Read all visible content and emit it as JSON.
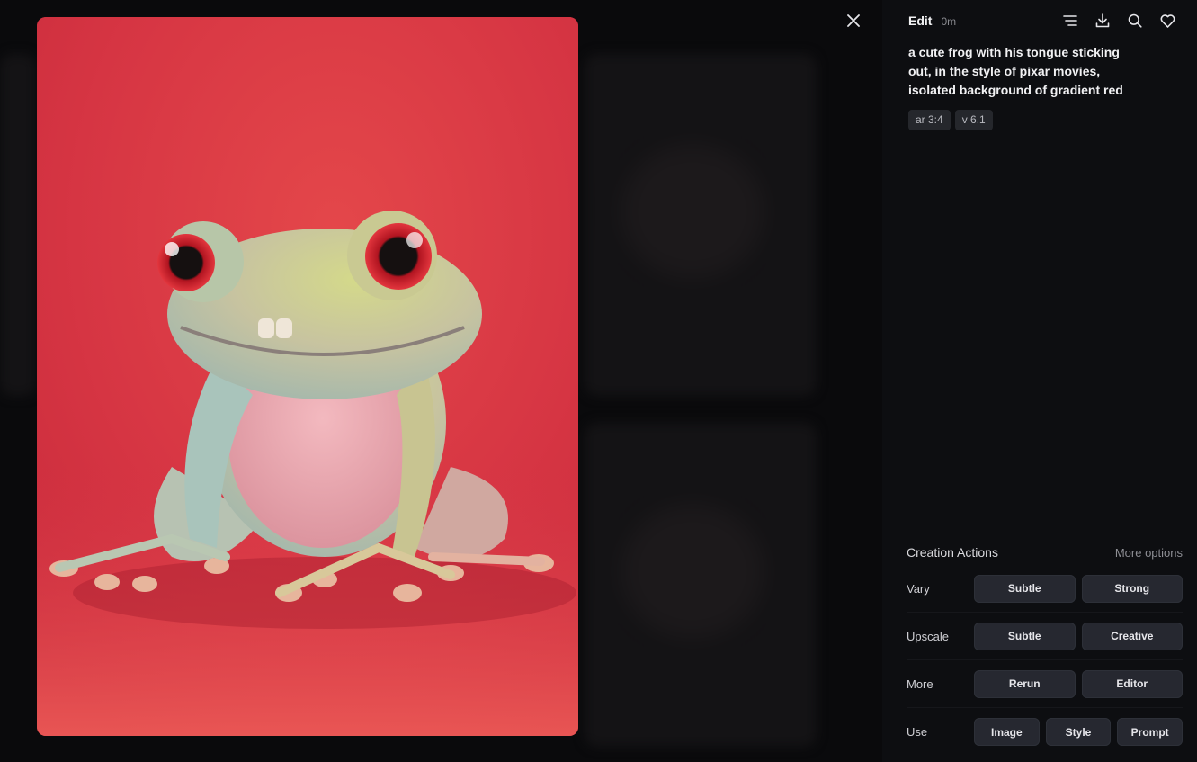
{
  "header": {
    "edit_label": "Edit",
    "time": "0m",
    "icons": [
      "menu-lines-icon",
      "download-icon",
      "search-icon",
      "heart-icon"
    ]
  },
  "image": {
    "subject": "frog"
  },
  "prompt": {
    "text": "a cute frog with his tongue sticking out, in the style of pixar movies, isolated background of gradient red"
  },
  "tags": [
    "ar 3:4",
    "v 6.1"
  ],
  "actions": {
    "title": "Creation Actions",
    "more_options": "More options",
    "rows": [
      {
        "label": "Vary",
        "buttons": [
          "Subtle",
          "Strong"
        ]
      },
      {
        "label": "Upscale",
        "buttons": [
          "Subtle",
          "Creative"
        ]
      },
      {
        "label": "More",
        "buttons": [
          "Rerun",
          "Editor"
        ]
      },
      {
        "label": "Use",
        "buttons": [
          "Image",
          "Style",
          "Prompt"
        ]
      }
    ]
  },
  "colors": {
    "background": "#0b0c0f",
    "panel": "#0d0e11",
    "button": "#262830",
    "image_red": "#d93a44"
  }
}
